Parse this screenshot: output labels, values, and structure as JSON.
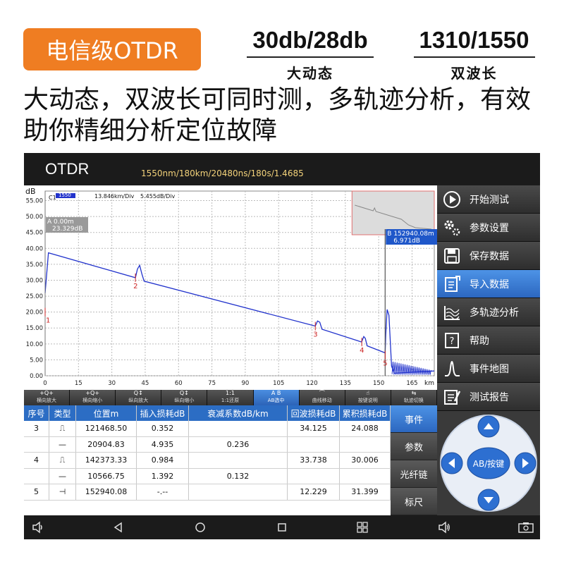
{
  "promo": {
    "badge": "电信级OTDR",
    "spec1_value": "30db/28db",
    "spec1_label": "大动态",
    "spec2_value": "1310/1550",
    "spec2_label": "双波长",
    "headline": "大动态，双波长可同时测，多轨迹分析，有效助你精细分析定位故障"
  },
  "app": {
    "title": "OTDR",
    "params": "1550nm/180km/20480ns/180s/1.4685"
  },
  "plot": {
    "y_unit": "dB",
    "x_unit": "km",
    "trace_label": "C1",
    "trace_tag": "1550",
    "x_div": "13.846km/Div",
    "y_div": "5.455dB/Div",
    "cursor_a_line1": "A 0.00m",
    "cursor_a_line2": "23.329dB",
    "cursor_b_line1": "B 152940.08m",
    "cursor_b_line2": "6.971dB",
    "y_ticks": [
      "55.00",
      "50.00",
      "45.00",
      "40.00",
      "35.00",
      "30.00",
      "25.00",
      "20.00",
      "15.00",
      "10.00",
      "5.00",
      "0.00"
    ],
    "x_ticks": [
      "0",
      "15",
      "30",
      "45",
      "60",
      "75",
      "90",
      "105",
      "120",
      "135",
      "150",
      "165"
    ],
    "event_markers": [
      "1",
      "2",
      "3",
      "4",
      "5"
    ],
    "trace_color": "#2233cc",
    "event_color": "#cc2222"
  },
  "chart_data": {
    "type": "line",
    "title": "",
    "xlabel": "km",
    "ylabel": "dB",
    "xlim": [
      0,
      175
    ],
    "ylim": [
      0,
      58
    ],
    "grid": true,
    "series": [
      {
        "name": "1550",
        "x": [
          0,
          1.5,
          40.6,
          41.5,
          42.5,
          43.5,
          44.5,
          121.5,
          122.5,
          123.5,
          124.5,
          142.3,
          143.3,
          144.0,
          144.8,
          152.9,
          153.2,
          153.8,
          154.6,
          155.8,
          157,
          175
        ],
        "y": [
          26,
          38.6,
          30.8,
          33.5,
          34.7,
          32,
          29.7,
          15.6,
          17.2,
          16.8,
          14.6,
          10.6,
          12.3,
          11.7,
          9.4,
          7.2,
          13,
          20.8,
          19,
          3,
          0.8,
          1.5
        ]
      }
    ],
    "events": [
      {
        "id": "1",
        "x": 0
      },
      {
        "id": "2",
        "x": 40.6
      },
      {
        "id": "3",
        "x": 121.5
      },
      {
        "id": "4",
        "x": 142.4
      },
      {
        "id": "5",
        "x": 152.9
      }
    ]
  },
  "toolbar": [
    {
      "icon": "+Q+",
      "label": "横向放大"
    },
    {
      "icon": "+Q+",
      "label": "横向缩小"
    },
    {
      "icon": "Q↕",
      "label": "纵向放大"
    },
    {
      "icon": "Q↕",
      "label": "纵向缩小"
    },
    {
      "icon": "1:1",
      "label": "1:1还原"
    },
    {
      "icon": "A B",
      "label": "AB选中"
    },
    {
      "icon": "⌒",
      "label": "曲线移动"
    },
    {
      "icon": "☝",
      "label": "按键说明"
    },
    {
      "icon": "⇆",
      "label": "轨迹切换"
    }
  ],
  "table": {
    "headers": [
      "序号",
      "类型",
      "位置m",
      "插入损耗dB",
      "衰减系数dB/km",
      "回波损耗dB",
      "累积损耗dB"
    ],
    "rows": [
      [
        "3",
        "⎍",
        "121468.50",
        "0.352",
        "",
        "34.125",
        "24.088"
      ],
      [
        "",
        "—",
        "20904.83",
        "4.935",
        "0.236",
        "",
        ""
      ],
      [
        "4",
        "⎍",
        "142373.33",
        "0.984",
        "",
        "33.738",
        "30.006"
      ],
      [
        "",
        "—",
        "10566.75",
        "1.392",
        "0.132",
        "",
        ""
      ],
      [
        "5",
        "⊣",
        "152940.08",
        "-.--",
        "",
        "12.229",
        "31.399"
      ]
    ]
  },
  "tabs": [
    "事件",
    "参数",
    "光纤链",
    "标尺"
  ],
  "menu": [
    {
      "label": "开始测试",
      "icon": "play-circle-icon"
    },
    {
      "label": "参数设置",
      "icon": "gears-icon"
    },
    {
      "label": "保存数据",
      "icon": "floppy-disk-icon"
    },
    {
      "label": "导入数据",
      "icon": "import-document-icon"
    },
    {
      "label": "多轨迹分析",
      "icon": "multi-trace-icon"
    },
    {
      "label": "帮助",
      "icon": "help-book-icon"
    },
    {
      "label": "事件地图",
      "icon": "event-map-icon"
    },
    {
      "label": "测试报告",
      "icon": "report-icon"
    }
  ],
  "pad": {
    "center": "AB/按键"
  }
}
